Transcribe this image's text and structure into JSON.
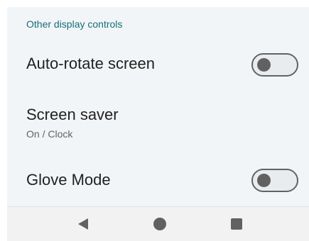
{
  "section": {
    "header": "Other display controls"
  },
  "settings": [
    {
      "title": "Auto-rotate screen",
      "toggle": "off"
    },
    {
      "title": "Screen saver",
      "subtitle": "On / Clock"
    },
    {
      "title": "Glove Mode",
      "toggle": "off"
    }
  ],
  "navigation": {
    "back_icon": "back-triangle-icon",
    "home_icon": "home-circle-icon",
    "recents_icon": "recents-square-icon"
  },
  "colors": {
    "panel_background": "#f2f5f7",
    "section_header": "#136f79",
    "title_text": "#212121",
    "subtitle_text": "#5f6368",
    "toggle_off_knob": "#616161",
    "nav_icon": "#616161"
  }
}
